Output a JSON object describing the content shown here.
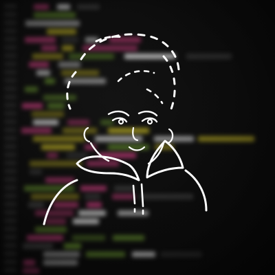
{
  "scene": {
    "description_kind": "illustration-over-blurred-code",
    "palette": {
      "background": "#0b0b0b",
      "code_green": "#5a7f2a",
      "code_pink": "#b0386f",
      "code_yellow": "#a59a22",
      "code_gray": "#3a3a3a",
      "code_white": "#cfcfcf",
      "sketch": "#ffffff"
    },
    "illustration": {
      "icon": "person-doodle-icon"
    }
  }
}
